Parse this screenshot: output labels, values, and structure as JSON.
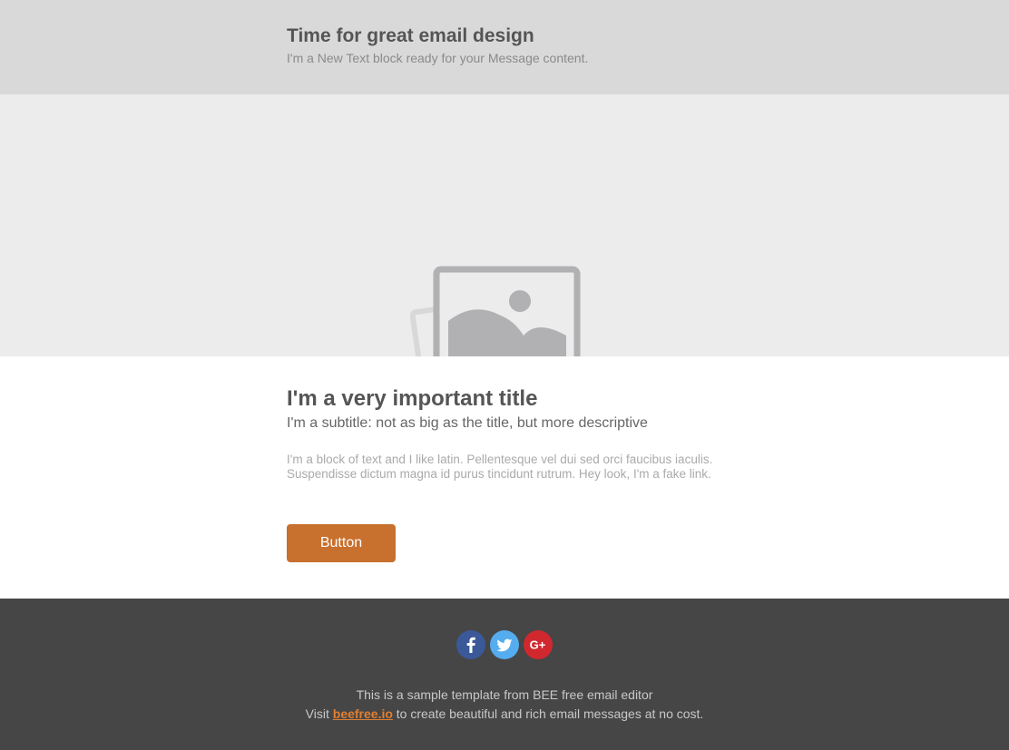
{
  "header": {
    "title": "Time for great email design",
    "subtitle": "I'm a New Text block ready for your Message content."
  },
  "hero": {
    "icon": "image-placeholder-icon"
  },
  "content": {
    "title": "I'm a very important title",
    "subtitle": "I'm a subtitle: not as big as the title, but more descriptive",
    "body_text": "I'm a block of text and I like latin. Pellentesque vel dui sed orci faucibus iaculis. Suspendisse dictum magna id purus tincidunt rutrum. Hey look, ",
    "fake_link": "I'm a fake link.",
    "button_label": "Button"
  },
  "footer": {
    "socials": [
      {
        "name": "facebook-icon",
        "glyph": "f",
        "color": "#3b5998"
      },
      {
        "name": "twitter-icon",
        "glyph": "bird",
        "color": "#55acee"
      },
      {
        "name": "google-plus-icon",
        "glyph": "G+",
        "color": "#d0282e"
      }
    ],
    "line1": "This is a sample template from BEE free email editor",
    "line2_prefix": "Visit ",
    "link_text": "beefree.io",
    "line2_suffix": " to create beautiful and rich email messages at no cost."
  },
  "colors": {
    "header_bg": "#d9d9d9",
    "hero_bg": "#ececec",
    "button_bg": "#c8702e",
    "footer_bg": "#464646",
    "link": "#e07f32"
  }
}
